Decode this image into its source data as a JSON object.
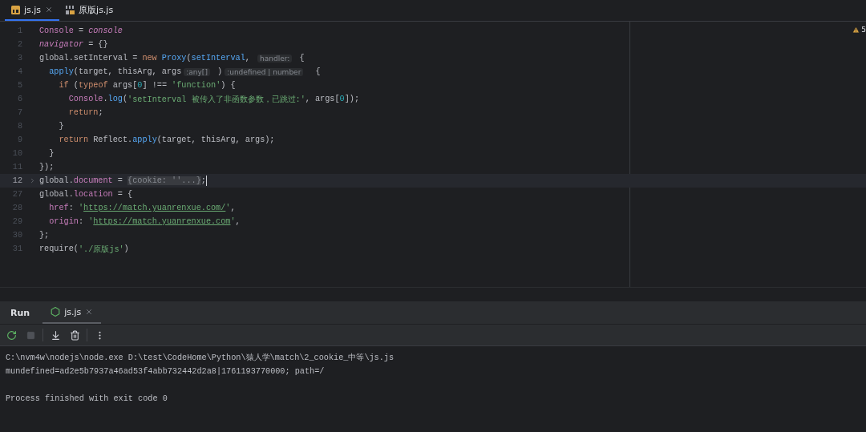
{
  "editor_tabs": [
    {
      "label": "js.js",
      "selected": true,
      "kind": "js",
      "closable": true
    },
    {
      "label": "原版js.js",
      "selected": false,
      "kind": "binary",
      "closable": false
    }
  ],
  "warnings": {
    "count": "5"
  },
  "code_lines": [
    {
      "number": "1",
      "current": false,
      "folded": false,
      "tokens": [
        {
          "kind": "var",
          "text": "Console"
        },
        {
          "kind": "plain",
          "text": " = "
        },
        {
          "kind": "var_italic",
          "text": "console"
        }
      ]
    },
    {
      "number": "2",
      "current": false,
      "folded": false,
      "tokens": [
        {
          "kind": "var_italic",
          "text": "navigator"
        },
        {
          "kind": "plain",
          "text": " = {}"
        }
      ]
    },
    {
      "number": "3",
      "current": false,
      "folded": false,
      "tokens": [
        {
          "kind": "plain",
          "text": "global.setInterval = "
        },
        {
          "kind": "keyword",
          "text": "new"
        },
        {
          "kind": "fn",
          "text": " Proxy"
        },
        {
          "kind": "plain",
          "text": "("
        },
        {
          "kind": "fn",
          "text": "setInterval"
        },
        {
          "kind": "plain",
          "text": ", "
        },
        {
          "kind": "hint",
          "text": "handler:"
        },
        {
          "kind": "plain",
          "text": " {"
        }
      ]
    },
    {
      "number": "4",
      "current": false,
      "folded": false,
      "tokens": [
        {
          "kind": "fn",
          "text": "  apply"
        },
        {
          "kind": "plain",
          "text": "(target, thisArg, args"
        },
        {
          "kind": "hint",
          "text": ":any[]"
        },
        {
          "kind": "plain",
          "text": " )"
        },
        {
          "kind": "hint",
          "text": ":undefined | number"
        },
        {
          "kind": "plain",
          "text": "  {"
        }
      ]
    },
    {
      "number": "5",
      "current": false,
      "folded": false,
      "tokens": [
        {
          "kind": "keyword",
          "text": "    if"
        },
        {
          "kind": "plain",
          "text": " ("
        },
        {
          "kind": "keyword",
          "text": "typeof"
        },
        {
          "kind": "plain",
          "text": " args["
        },
        {
          "kind": "number",
          "text": "0"
        },
        {
          "kind": "plain",
          "text": "] !== "
        },
        {
          "kind": "string",
          "text": "'function'"
        },
        {
          "kind": "plain",
          "text": ") {"
        }
      ]
    },
    {
      "number": "6",
      "current": false,
      "folded": false,
      "tokens": [
        {
          "kind": "var",
          "text": "      Console"
        },
        {
          "kind": "plain",
          "text": "."
        },
        {
          "kind": "fn",
          "text": "log"
        },
        {
          "kind": "plain",
          "text": "("
        },
        {
          "kind": "string",
          "text": "'setInterval 被传入了非函数参数，已跳过:'"
        },
        {
          "kind": "plain",
          "text": ", args["
        },
        {
          "kind": "number",
          "text": "0"
        },
        {
          "kind": "plain",
          "text": "]);"
        }
      ]
    },
    {
      "number": "7",
      "current": false,
      "folded": false,
      "tokens": [
        {
          "kind": "keyword",
          "text": "      return"
        },
        {
          "kind": "plain",
          "text": ";"
        }
      ]
    },
    {
      "number": "8",
      "current": false,
      "folded": false,
      "tokens": [
        {
          "kind": "plain",
          "text": "    }"
        }
      ]
    },
    {
      "number": "9",
      "current": false,
      "folded": false,
      "tokens": [
        {
          "kind": "keyword",
          "text": "    return"
        },
        {
          "kind": "plain",
          "text": " Reflect."
        },
        {
          "kind": "fn",
          "text": "apply"
        },
        {
          "kind": "plain",
          "text": "(target, thisArg, args);"
        }
      ]
    },
    {
      "number": "10",
      "current": false,
      "folded": false,
      "tokens": [
        {
          "kind": "plain",
          "text": "  }"
        }
      ]
    },
    {
      "number": "11",
      "current": false,
      "folded": false,
      "tokens": [
        {
          "kind": "plain",
          "text": "});"
        }
      ]
    },
    {
      "number": "12",
      "current": true,
      "folded": true,
      "tokens": [
        {
          "kind": "plain",
          "text": "global."
        },
        {
          "kind": "var",
          "text": "document"
        },
        {
          "kind": "plain",
          "text": " = "
        },
        {
          "kind": "fold",
          "text": "{cookie: ''...}"
        },
        {
          "kind": "plain",
          "text": ";"
        }
      ]
    },
    {
      "number": "27",
      "current": false,
      "folded": false,
      "tokens": [
        {
          "kind": "plain",
          "text": "global."
        },
        {
          "kind": "var",
          "text": "location"
        },
        {
          "kind": "plain",
          "text": " = {"
        }
      ]
    },
    {
      "number": "28",
      "current": false,
      "folded": false,
      "tokens": [
        {
          "kind": "var",
          "text": "  href"
        },
        {
          "kind": "plain",
          "text": ": "
        },
        {
          "kind": "string",
          "text": "'"
        },
        {
          "kind": "link",
          "text": "https://match.yuanrenxue.com/"
        },
        {
          "kind": "string",
          "text": "'"
        },
        {
          "kind": "plain",
          "text": ","
        }
      ]
    },
    {
      "number": "29",
      "current": false,
      "folded": false,
      "tokens": [
        {
          "kind": "var",
          "text": "  origin"
        },
        {
          "kind": "plain",
          "text": ": "
        },
        {
          "kind": "string",
          "text": "'"
        },
        {
          "kind": "link",
          "text": "https://match.yuanrenxue.com"
        },
        {
          "kind": "string",
          "text": "'"
        },
        {
          "kind": "plain",
          "text": ","
        }
      ]
    },
    {
      "number": "30",
      "current": false,
      "folded": false,
      "tokens": [
        {
          "kind": "plain",
          "text": "};"
        }
      ]
    },
    {
      "number": "31",
      "current": false,
      "folded": false,
      "tokens": [
        {
          "kind": "plain",
          "text": "require("
        },
        {
          "kind": "string",
          "text": "'./原版js'"
        },
        {
          "kind": "plain",
          "text": ")"
        }
      ]
    }
  ],
  "run_panel": {
    "title": "Run",
    "tabs": [
      {
        "label": "js.js",
        "selected": true
      }
    ],
    "toolbar": [
      {
        "kind": "rerun",
        "disabled": false
      },
      {
        "kind": "stop",
        "disabled": true
      },
      {
        "kind": "separator"
      },
      {
        "kind": "scroll_end",
        "disabled": false
      },
      {
        "kind": "clear",
        "disabled": false
      },
      {
        "kind": "separator"
      },
      {
        "kind": "more",
        "disabled": false
      }
    ],
    "output": [
      {
        "kind": "stdout",
        "text": "C:\\nvm4w\\nodejs\\node.exe D:\\test\\CodeHome\\Python\\猿人学\\match\\2_cookie_中等\\js.js"
      },
      {
        "kind": "stdout",
        "text": "mundefined=ad2e5b7937a46ad53f4abb732442d2a8|1761193770000; path=/"
      },
      {
        "kind": "exit",
        "text": "Process finished with exit code 0"
      }
    ]
  }
}
